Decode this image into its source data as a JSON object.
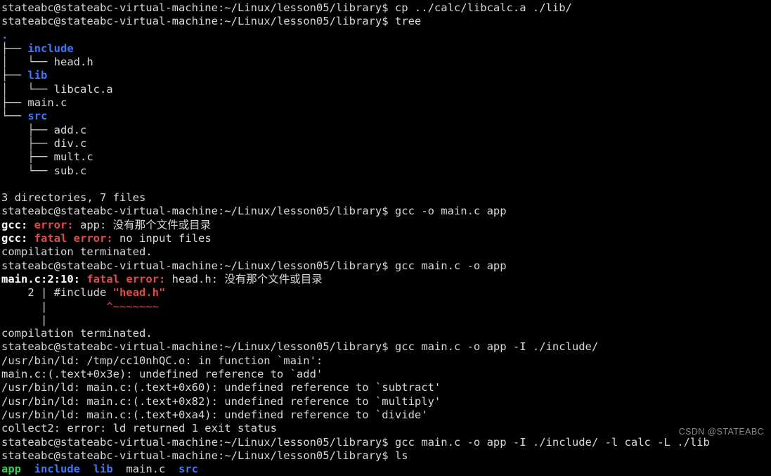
{
  "terminal": {
    "prompt": "stateabc@stateabc-virtual-machine:~/Linux/lesson05/library$ ",
    "colors": {
      "background": "#000000",
      "foreground": "#d8d8d8",
      "directory": "#3b78ff",
      "executable": "#2fd14f",
      "error": "#e04a4a",
      "bold_white": "#ffffff",
      "watermark": "#8a8a8a"
    },
    "watermark": "CSDN @STATEABC",
    "commands": {
      "cp": "cp ../calc/libcalc.a ./lib/",
      "tree": "tree",
      "gcc_bad_order": "gcc -o main.c app",
      "gcc_no_include": "gcc main.c -o app",
      "gcc_with_include": "gcc main.c -o app -I ./include/",
      "gcc_full": "gcc main.c -o app -I ./include/ -l calc -L ./lib",
      "ls": "ls"
    },
    "tree_output": {
      "root": ".",
      "entries": [
        {
          "branch": "├── ",
          "name": "include",
          "kind": "dir"
        },
        {
          "branch": "│   └── ",
          "name": "head.h",
          "kind": "file"
        },
        {
          "branch": "├── ",
          "name": "lib",
          "kind": "dir"
        },
        {
          "branch": "│   └── ",
          "name": "libcalc.a",
          "kind": "file"
        },
        {
          "branch": "├── ",
          "name": "main.c",
          "kind": "file"
        },
        {
          "branch": "└── ",
          "name": "src",
          "kind": "dir"
        },
        {
          "branch": "    ├── ",
          "name": "add.c",
          "kind": "file"
        },
        {
          "branch": "    ├── ",
          "name": "div.c",
          "kind": "file"
        },
        {
          "branch": "    ├── ",
          "name": "mult.c",
          "kind": "file"
        },
        {
          "branch": "    └── ",
          "name": "sub.c",
          "kind": "file"
        }
      ],
      "summary": "3 directories, 7 files"
    },
    "gcc_errors_1": {
      "line1_prefix": "gcc: ",
      "line1_kind": "error: ",
      "line1_rest": "app: 没有那个文件或目录",
      "line2_prefix": "gcc: ",
      "line2_kind": "fatal error: ",
      "line2_rest": "no input files",
      "line3": "compilation terminated."
    },
    "gcc_errors_2": {
      "loc": "main.c:2:10: ",
      "kind": "fatal error: ",
      "rest": "head.h: 没有那个文件或目录",
      "src_prefix": "    2 | #include ",
      "src_quoted": "\"head.h\"",
      "caret_pad": "      | ",
      "caret_indent": "        ",
      "caret": "^~~~~~~~",
      "bar_line": "      |",
      "terminated": "compilation terminated."
    },
    "ld_errors": [
      "/usr/bin/ld: /tmp/cc10nhQC.o: in function `main':",
      "main.c:(.text+0x3e): undefined reference to `add'",
      "/usr/bin/ld: main.c:(.text+0x60): undefined reference to `subtract'",
      "/usr/bin/ld: main.c:(.text+0x82): undefined reference to `multiply'",
      "/usr/bin/ld: main.c:(.text+0xa4): undefined reference to `divide'",
      "collect2: error: ld returned 1 exit status"
    ],
    "ls_output": [
      {
        "name": "app",
        "kind": "exe"
      },
      {
        "name": "include",
        "kind": "dir"
      },
      {
        "name": "lib",
        "kind": "dir"
      },
      {
        "name": "main.c",
        "kind": "file"
      },
      {
        "name": "src",
        "kind": "dir"
      }
    ]
  }
}
